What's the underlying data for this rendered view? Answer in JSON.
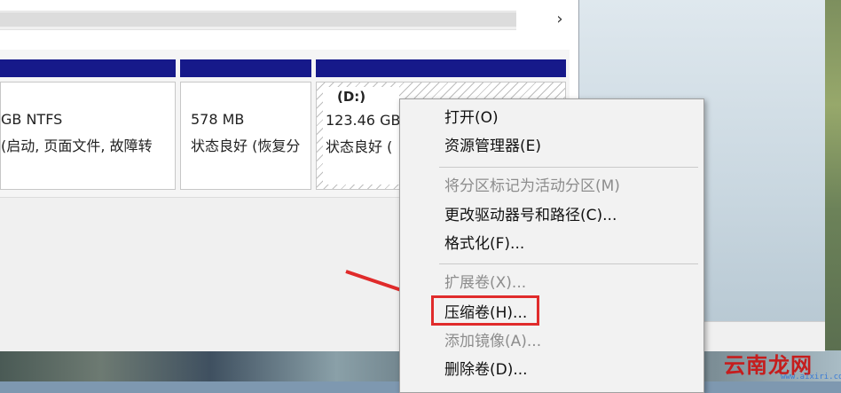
{
  "volumes": [
    {
      "size": "GB NTFS",
      "status": "(启动, 页面文件, 故障转"
    },
    {
      "size": "578 MB",
      "status": "状态良好 (恢复分"
    },
    {
      "label": "(D:)",
      "size": "123.46 GB",
      "status": "状态良好 ("
    }
  ],
  "scroll": {
    "right_arrow": "›"
  },
  "context_menu": {
    "items": [
      {
        "label": "打开(O)",
        "enabled": true
      },
      {
        "label": "资源管理器(E)",
        "enabled": true
      },
      {
        "label": "将分区标记为活动分区(M)",
        "enabled": false
      },
      {
        "label": "更改驱动器号和路径(C)...",
        "enabled": true
      },
      {
        "label": "格式化(F)...",
        "enabled": true
      },
      {
        "label": "扩展卷(X)...",
        "enabled": false
      },
      {
        "label": "压缩卷(H)...",
        "enabled": true,
        "highlighted": true
      },
      {
        "label": "添加镜像(A)...",
        "enabled": false
      },
      {
        "label": "删除卷(D)...",
        "enabled": true
      }
    ]
  },
  "watermark": {
    "logo": "云南龙网",
    "url": "www.aixiri.com"
  },
  "colors": {
    "volume_header": "#16198a",
    "highlight": "#e02b2b",
    "arrow": "#e02b2b",
    "disabled_text": "#8d8d8d"
  }
}
